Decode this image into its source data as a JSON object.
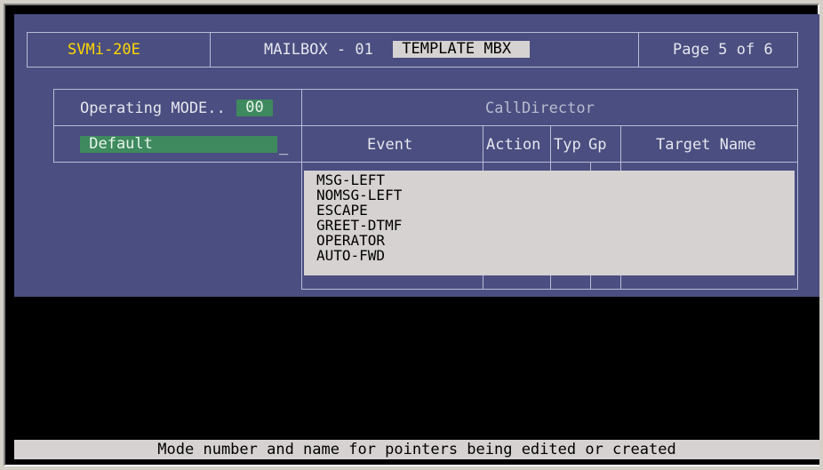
{
  "header": {
    "system": "SVMi-20E",
    "mailbox_label": "MAILBOX - 01",
    "mailbox_name": " TEMPLATE MBX  ",
    "page": "Page 5 of 6"
  },
  "mode": {
    "label": "Operating MODE..",
    "value": " 00 ",
    "name": " Default",
    "cursor": "_"
  },
  "call_director": {
    "title": "CallDirector",
    "columns": [
      "Event",
      "Action",
      "Typ",
      "Gp",
      "Target Name"
    ]
  },
  "event_list": {
    "items": [
      "MSG-LEFT",
      "NOMSG-LEFT",
      "ESCAPE",
      "GREET-DTMF",
      "OPERATOR",
      "AUTO-FWD"
    ]
  },
  "status_bar": {
    "message": "Mode number and name for pointers being edited or created"
  },
  "colors": {
    "panel": "#4a4e80",
    "highlight_green": "#3e8a5e",
    "inverse": "#d6d2d2",
    "system_yellow": "#ffd700"
  }
}
